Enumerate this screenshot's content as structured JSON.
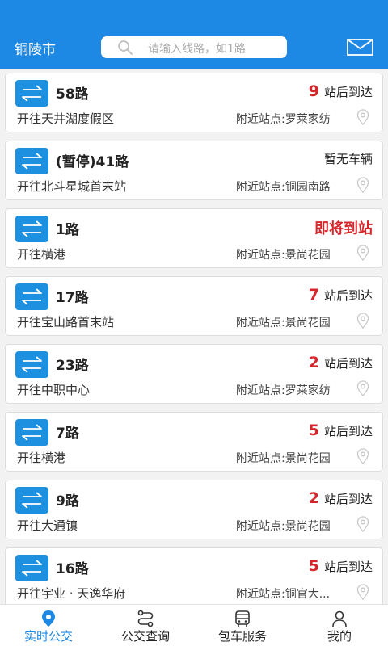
{
  "header": {
    "city": "铜陵市",
    "search_placeholder": "请输入线路，如1路"
  },
  "routes": [
    {
      "name": "58路",
      "direction": "开往天井湖度假区",
      "status_num": "9",
      "status_text": "站后到达",
      "nearby_label": "附近站点:",
      "nearby_stop": "罗莱家纺"
    },
    {
      "name": "(暂停)41路",
      "direction": "开往北斗星城首末站",
      "status_num": "",
      "status_text": "暂无车辆",
      "nearby_label": "附近站点:",
      "nearby_stop": "铜园南路"
    },
    {
      "name": "1路",
      "direction": "开往横港",
      "status_num": "",
      "status_text": "即将到站",
      "nearby_label": "附近站点:",
      "nearby_stop": "景尚花园"
    },
    {
      "name": "17路",
      "direction": "开往宝山路首末站",
      "status_num": "7",
      "status_text": "站后到达",
      "nearby_label": "附近站点:",
      "nearby_stop": "景尚花园"
    },
    {
      "name": "23路",
      "direction": "开往中职中心",
      "status_num": "2",
      "status_text": "站后到达",
      "nearby_label": "附近站点:",
      "nearby_stop": "罗莱家纺"
    },
    {
      "name": "7路",
      "direction": "开往横港",
      "status_num": "5",
      "status_text": "站后到达",
      "nearby_label": "附近站点:",
      "nearby_stop": "景尚花园"
    },
    {
      "name": "9路",
      "direction": "开往大通镇",
      "status_num": "2",
      "status_text": "站后到达",
      "nearby_label": "附近站点:",
      "nearby_stop": "景尚花园"
    },
    {
      "name": "16路",
      "direction": "开往宇业 · 天逸华府",
      "status_num": "5",
      "status_text": "站后到达",
      "nearby_label": "附近站点:",
      "nearby_stop": "铜官大..."
    }
  ],
  "tabs": [
    {
      "label": "实时公交",
      "icon": "location-pin-icon",
      "active": true
    },
    {
      "label": "公交查询",
      "icon": "route-icon",
      "active": false
    },
    {
      "label": "包车服务",
      "icon": "bus-icon",
      "active": false
    },
    {
      "label": "我的",
      "icon": "user-icon",
      "active": false
    }
  ],
  "colors": {
    "primary": "#1e88e5",
    "badge": "#1e90e0",
    "alert_red": "#d7262b",
    "background": "#f2f2f2"
  }
}
